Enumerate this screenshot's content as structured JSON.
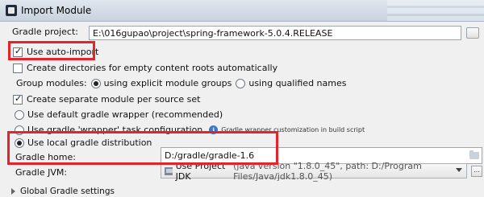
{
  "window": {
    "title": "Import Module"
  },
  "gradle_project": {
    "label": "Gradle project:",
    "value": "E:\\016gupao\\project\\spring-framework-5.0.4.RELEASE"
  },
  "options": {
    "auto_import": "Use auto-import",
    "create_dirs": "Create directories for empty content roots automatically",
    "group_modules_label": "Group modules:",
    "group_explicit": "using explicit module groups",
    "group_qualified": "using qualified names",
    "separate_module": "Create separate module per source set",
    "default_wrapper": "Use default gradle wrapper (recommended)",
    "wrapper_task": "Use gradle 'wrapper' task configuration",
    "wrapper_hint": "Gradle wrapper customization in build script",
    "local_distribution": "Use local gradle distribution"
  },
  "gradle_home": {
    "label": "Gradle home:",
    "value": "D:/gradle/gradle-1.6"
  },
  "gradle_jvm": {
    "label": "Gradle JVM:",
    "selected": "Use Project JDK",
    "detail": "(java version \"1.8.0_45\", path: D:/Program Files/Java/jdk1.8.0_45)"
  },
  "global_settings": "Global Gradle settings",
  "colors": {
    "highlight": "#e5232d",
    "info": "#3a78c9"
  },
  "icons": [
    "app-icon",
    "folder-icon",
    "info-icon",
    "jdk-icon",
    "chevron-down-icon",
    "expand-triangle-icon"
  ]
}
